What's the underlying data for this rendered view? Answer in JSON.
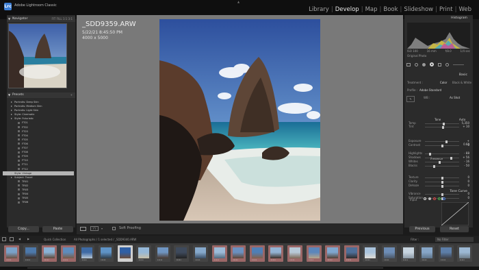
{
  "app": {
    "logo_text": "Lrc",
    "name": "Adobe Lightroom Classic"
  },
  "modules": [
    "Library",
    "Develop",
    "Map",
    "Book",
    "Slideshow",
    "Print",
    "Web"
  ],
  "active_module": "Develop",
  "left_panel": {
    "navigator": {
      "title": "Navigator",
      "zoom_options": "FIT  FILL  1:1  3:1"
    },
    "presets": {
      "title": "Presets",
      "items": [
        {
          "label": "Portraits: Deep Skin",
          "level": 0,
          "selected": false
        },
        {
          "label": "Portraits: Medium Skin",
          "level": 0,
          "selected": false
        },
        {
          "label": "Portraits: Light Skin",
          "level": 0,
          "selected": false
        },
        {
          "label": "Style: Cinematic",
          "level": 0,
          "selected": false
        },
        {
          "label": "Style: Futuristic",
          "level": 0,
          "selected": false
        },
        {
          "label": "FT01",
          "level": 1,
          "selected": false
        },
        {
          "label": "FT02",
          "level": 1,
          "selected": false
        },
        {
          "label": "FT03",
          "level": 1,
          "selected": false
        },
        {
          "label": "FT04",
          "level": 1,
          "selected": false
        },
        {
          "label": "FT05",
          "level": 1,
          "selected": false
        },
        {
          "label": "FT06",
          "level": 1,
          "selected": false
        },
        {
          "label": "FT07",
          "level": 1,
          "selected": false
        },
        {
          "label": "FT08",
          "level": 1,
          "selected": false
        },
        {
          "label": "FT09",
          "level": 1,
          "selected": false
        },
        {
          "label": "FT10",
          "level": 1,
          "selected": false
        },
        {
          "label": "FT11",
          "level": 1,
          "selected": false
        },
        {
          "label": "FT12",
          "level": 1,
          "selected": false
        },
        {
          "label": "Style: Vintage",
          "level": 0,
          "selected": true
        },
        {
          "label": "Subject: Travel",
          "level": 0,
          "selected": false
        },
        {
          "label": "TR01",
          "level": 1,
          "selected": false
        },
        {
          "label": "TR02",
          "level": 1,
          "selected": false
        },
        {
          "label": "TR03",
          "level": 1,
          "selected": false
        },
        {
          "label": "TR04",
          "level": 1,
          "selected": false
        },
        {
          "label": "TR05",
          "level": 1,
          "selected": false
        },
        {
          "label": "TR06",
          "level": 1,
          "selected": false
        }
      ]
    },
    "copy_label": "Copy...",
    "paste_label": "Paste"
  },
  "photo_info": {
    "filename": "_SDD9359.ARW",
    "datetime": "5/22/21 8:45:50 PM",
    "dimensions": "4000 x 5000"
  },
  "toolbar": {
    "soft_proofing_label": "Soft Proofing"
  },
  "right_panel": {
    "histogram": {
      "title": "Histogram",
      "meta": [
        "ISO 100",
        "16 mm",
        "f/8.0",
        "1/4 sec"
      ],
      "original_photo_label": "Original Photo"
    },
    "basic": {
      "title": "Basic",
      "treatment_label": "Treatment :",
      "color_label": "Color",
      "bw_label": "Black & White",
      "profile_label": "Profile :",
      "profile_value": "Adobe Standard",
      "wb_label": "WB :",
      "wb_value": "As Shot",
      "tone_label": "Tone",
      "auto_label": "Auto",
      "presence_label": "Presence",
      "sliders": [
        {
          "label": "Temp",
          "value": "5,350",
          "pos": 0.55
        },
        {
          "label": "Tint",
          "value": "+ 10",
          "pos": 0.53
        },
        {
          "label": "Exposure",
          "value": "+ 0.60",
          "pos": 0.62
        },
        {
          "label": "Contrast",
          "value": "0",
          "pos": 0.5
        },
        {
          "label": "Highlights",
          "value": "- 88",
          "pos": 0.12
        },
        {
          "label": "Shadows",
          "value": "+ 56",
          "pos": 0.78
        },
        {
          "label": "Whites",
          "value": "- 16",
          "pos": 0.42
        },
        {
          "label": "Blacks",
          "value": "- 50",
          "pos": 0.25
        },
        {
          "label": "Texture",
          "value": "0",
          "pos": 0.5
        },
        {
          "label": "Clarity",
          "value": "0",
          "pos": 0.5
        },
        {
          "label": "Dehaze",
          "value": "0",
          "pos": 0.5
        },
        {
          "label": "Vibrance",
          "value": "0",
          "pos": 0.5
        },
        {
          "label": "Saturation",
          "value": "0",
          "pos": 0.5
        }
      ]
    },
    "tone_curve": {
      "title": "Tone Curve",
      "input_label": "Input"
    },
    "previous_label": "Previous",
    "reset_label": "Reset"
  },
  "filmstrip": {
    "nav": "Quick Collection",
    "path": "All Photographs / 1 selected / _SDD9340.ARW",
    "filter_label": "Filter :",
    "filter_value": "No Filter",
    "count": 25,
    "selected_index": 6,
    "pink_indices": [
      0,
      2,
      3,
      11,
      12,
      13,
      14,
      15,
      16,
      17,
      18
    ]
  },
  "colors": {
    "accent": "#3d7fd6",
    "panel": "#2b2b2b",
    "center": "#797979",
    "pink_label": "#9b6767"
  }
}
